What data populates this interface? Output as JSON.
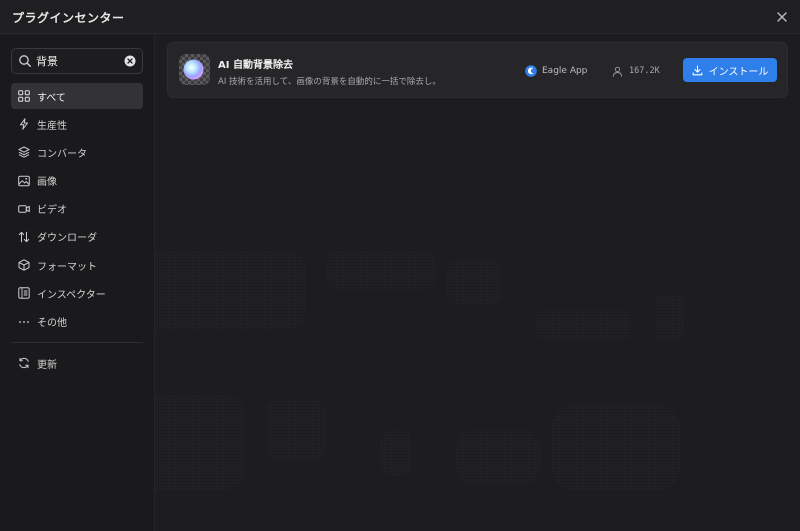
{
  "window": {
    "title": "プラグインセンター",
    "close_icon": "close-icon"
  },
  "search": {
    "value": "背景",
    "icon": "search-icon",
    "clear_icon": "clear-circle-icon"
  },
  "sidebar": {
    "items": [
      {
        "label": "すべて",
        "icon": "grid-icon",
        "active": true
      },
      {
        "label": "生産性",
        "icon": "lightning-icon"
      },
      {
        "label": "コンバータ",
        "icon": "layers-icon"
      },
      {
        "label": "画像",
        "icon": "image-icon"
      },
      {
        "label": "ビデオ",
        "icon": "video-icon"
      },
      {
        "label": "ダウンローダ",
        "icon": "transfer-arrows-icon"
      },
      {
        "label": "フォーマット",
        "icon": "cube-icon"
      },
      {
        "label": "インスペクター",
        "icon": "inspector-icon"
      },
      {
        "label": "その他",
        "icon": "more-dots-icon"
      }
    ],
    "refresh": {
      "label": "更新",
      "icon": "refresh-icon"
    }
  },
  "plugins": [
    {
      "name": "AI 自動背景除去",
      "description": "AI 技術を活用して、画像の背景を自動的に一括で除去し。",
      "author": "Eagle App",
      "downloads": "167.2K",
      "install_label": "インストール",
      "icon": "ai-remove-background-icon"
    }
  ],
  "colors": {
    "accent": "#2f7fea",
    "background": "#1d1d1f",
    "sidebar": "#1a1a1c",
    "card": "#262628"
  }
}
